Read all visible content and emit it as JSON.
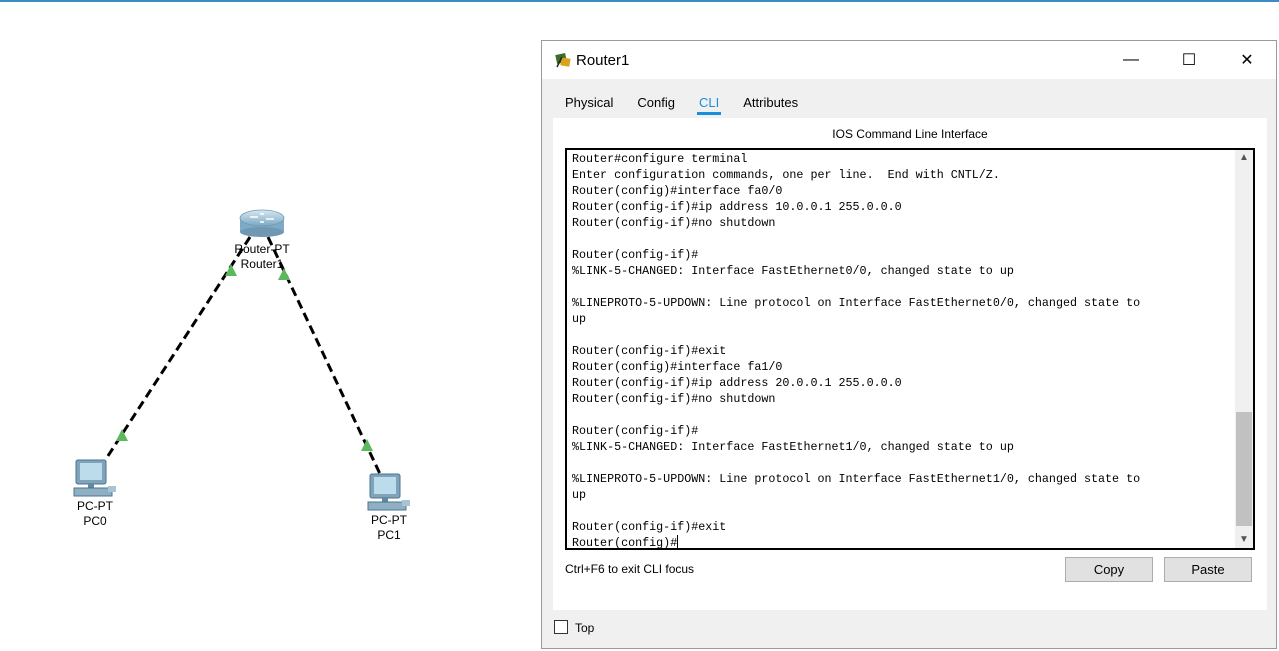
{
  "topology": {
    "devices": [
      {
        "type": "Router-PT",
        "name": "Router1"
      },
      {
        "type": "PC-PT",
        "name": "PC0"
      },
      {
        "type": "PC-PT",
        "name": "PC1"
      }
    ]
  },
  "window": {
    "title": "Router1",
    "controls": {
      "minimize": "—",
      "maximize": "☐",
      "close": "✕"
    },
    "tabs": [
      {
        "label": "Physical",
        "active": false
      },
      {
        "label": "Config",
        "active": false
      },
      {
        "label": "CLI",
        "active": true
      },
      {
        "label": "Attributes",
        "active": false
      }
    ],
    "panel_title": "IOS Command Line Interface",
    "cli_lines": [
      "Router#configure terminal",
      "Enter configuration commands, one per line.  End with CNTL/Z.",
      "Router(config)#interface fa0/0",
      "Router(config-if)#ip address 10.0.0.1 255.0.0.0",
      "Router(config-if)#no shutdown",
      "",
      "Router(config-if)#",
      "%LINK-5-CHANGED: Interface FastEthernet0/0, changed state to up",
      "",
      "%LINEPROTO-5-UPDOWN: Line protocol on Interface FastEthernet0/0, changed state to",
      "up",
      "",
      "Router(config-if)#exit",
      "Router(config)#interface fa1/0",
      "Router(config-if)#ip address 20.0.0.1 255.0.0.0",
      "Router(config-if)#no shutdown",
      "",
      "Router(config-if)#",
      "%LINK-5-CHANGED: Interface FastEthernet1/0, changed state to up",
      "",
      "%LINEPROTO-5-UPDOWN: Line protocol on Interface FastEthernet1/0, changed state to",
      "up",
      "",
      "Router(config-if)#exit"
    ],
    "cli_prompt": "Router(config)#",
    "hint": "Ctrl+F6 to exit CLI focus",
    "copy_label": "Copy",
    "paste_label": "Paste",
    "top_checkbox": {
      "label": "Top",
      "checked": false
    }
  },
  "colors": {
    "accent": "#1a8fd8",
    "link_up": "#5cb85c",
    "topbar": "#3b8cc4"
  }
}
